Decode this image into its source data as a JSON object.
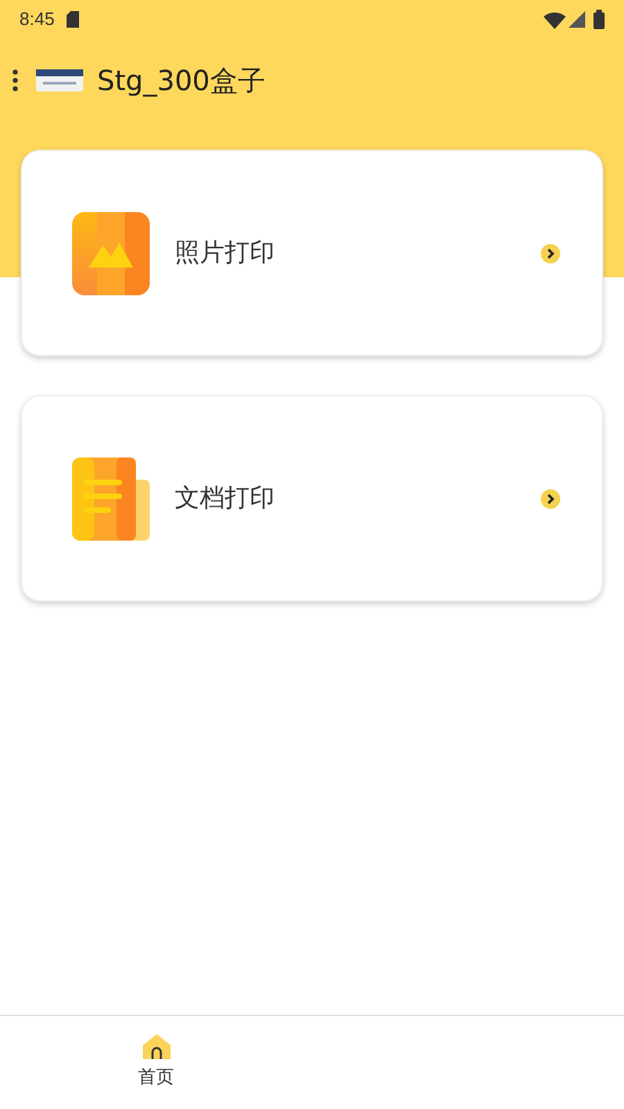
{
  "status_bar": {
    "time": "8:45"
  },
  "app_bar": {
    "title": "Stg_300盒子"
  },
  "cards": [
    {
      "kind": "photo",
      "label": "照片打印"
    },
    {
      "kind": "document",
      "label": "文档打印"
    }
  ],
  "bottom_nav": [
    {
      "label": "首页",
      "selected": true
    }
  ]
}
